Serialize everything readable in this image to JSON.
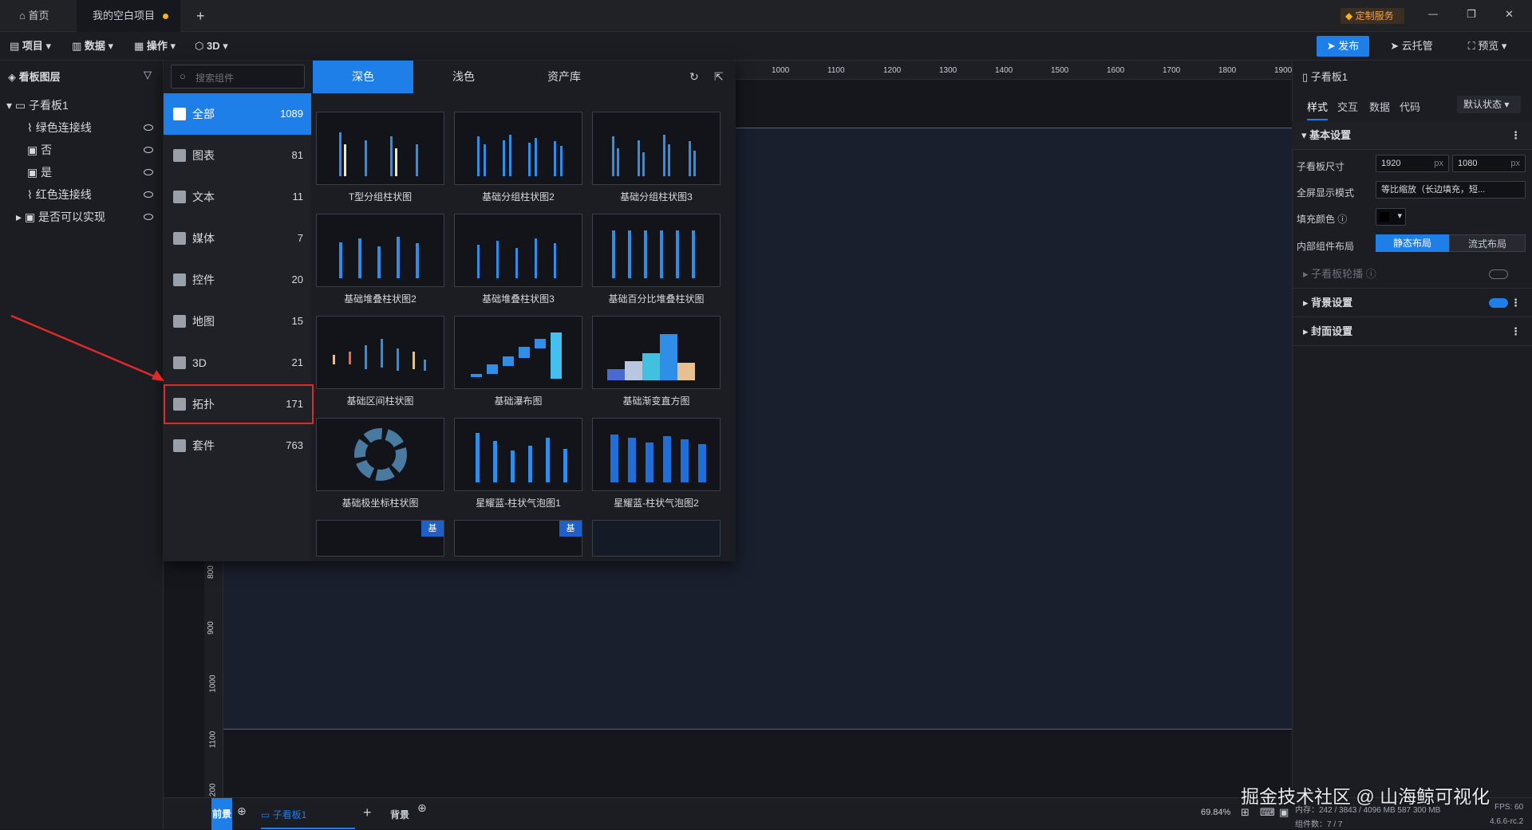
{
  "tabbar": {
    "home_label": "首页",
    "project_tab": "我的空白项目",
    "add_tab": "+",
    "custom_service": "定制服务",
    "min": "—",
    "restore": "❐",
    "close": "✕"
  },
  "toolbar": {
    "menus": [
      "项目",
      "数据",
      "操作",
      "3D"
    ],
    "publish": "发布",
    "cloud": "云托管",
    "preview": "预览"
  },
  "layers": {
    "title": "看板图层",
    "root": "子看板1",
    "items": [
      "绿色连接线",
      "否",
      "是",
      "红色连接线",
      "是否可以实现"
    ]
  },
  "library": {
    "search_placeholder": "搜索组件",
    "tabs": [
      "深色",
      "浅色",
      "资产库"
    ],
    "categories": [
      {
        "label": "全部",
        "count": "1089"
      },
      {
        "label": "图表",
        "count": "81"
      },
      {
        "label": "文本",
        "count": "11"
      },
      {
        "label": "媒体",
        "count": "7"
      },
      {
        "label": "控件",
        "count": "20"
      },
      {
        "label": "地图",
        "count": "15"
      },
      {
        "label": "3D",
        "count": "21"
      },
      {
        "label": "拓扑",
        "count": "171"
      },
      {
        "label": "套件",
        "count": "763"
      }
    ],
    "components": [
      "T型分组柱状图",
      "基础分组柱状图2",
      "基础分组柱状图3",
      "基础堆叠柱状图2",
      "基础堆叠柱状图3",
      "基础百分比堆叠柱状图",
      "基础区间柱状图",
      "基础瀑布图",
      "基础渐变直方图",
      "基础极坐标柱状图",
      "星耀蓝-柱状气泡图1",
      "星耀蓝-柱状气泡图2"
    ],
    "badge": "基"
  },
  "ruler": {
    "top": [
      "1000",
      "1100",
      "1200",
      "1300",
      "1400",
      "1500",
      "1600",
      "1700",
      "1800",
      "1900"
    ],
    "left": [
      "800",
      "900",
      "1000",
      "1100",
      "1200"
    ]
  },
  "props": {
    "title": "子看板1",
    "tabs": [
      "样式",
      "交互",
      "数据",
      "代码"
    ],
    "state": "默认状态",
    "basic": "基本设置",
    "size_label": "子看板尺寸",
    "width": "1920",
    "height": "1080",
    "unit": "px",
    "fullscreen_label": "全屏显示模式",
    "fullscreen_value": "等比缩放（长边填充，短...",
    "fill_label": "填充颜色",
    "layout_label": "内部组件布局",
    "layout_static": "静态布局",
    "layout_flow": "流式布局",
    "carousel": "子看板轮播",
    "bg": "背景设置",
    "cover": "封面设置"
  },
  "bottom": {
    "front": "前景",
    "sub": "子看板1",
    "add": "+",
    "back": "背景",
    "zoom": "69.84%",
    "mem": "内存：242 / 3843 / 4096 MB 587 300 MB",
    "fps": "FPS: 60",
    "comps": "组件数：7 / 7",
    "ver": "4.6.6-rc.2",
    "watermark": "掘金技术社区 @ 山海鲸可视化"
  },
  "colors": {
    "accent": "#1e7fe8",
    "annotation": "#e02a2a"
  }
}
